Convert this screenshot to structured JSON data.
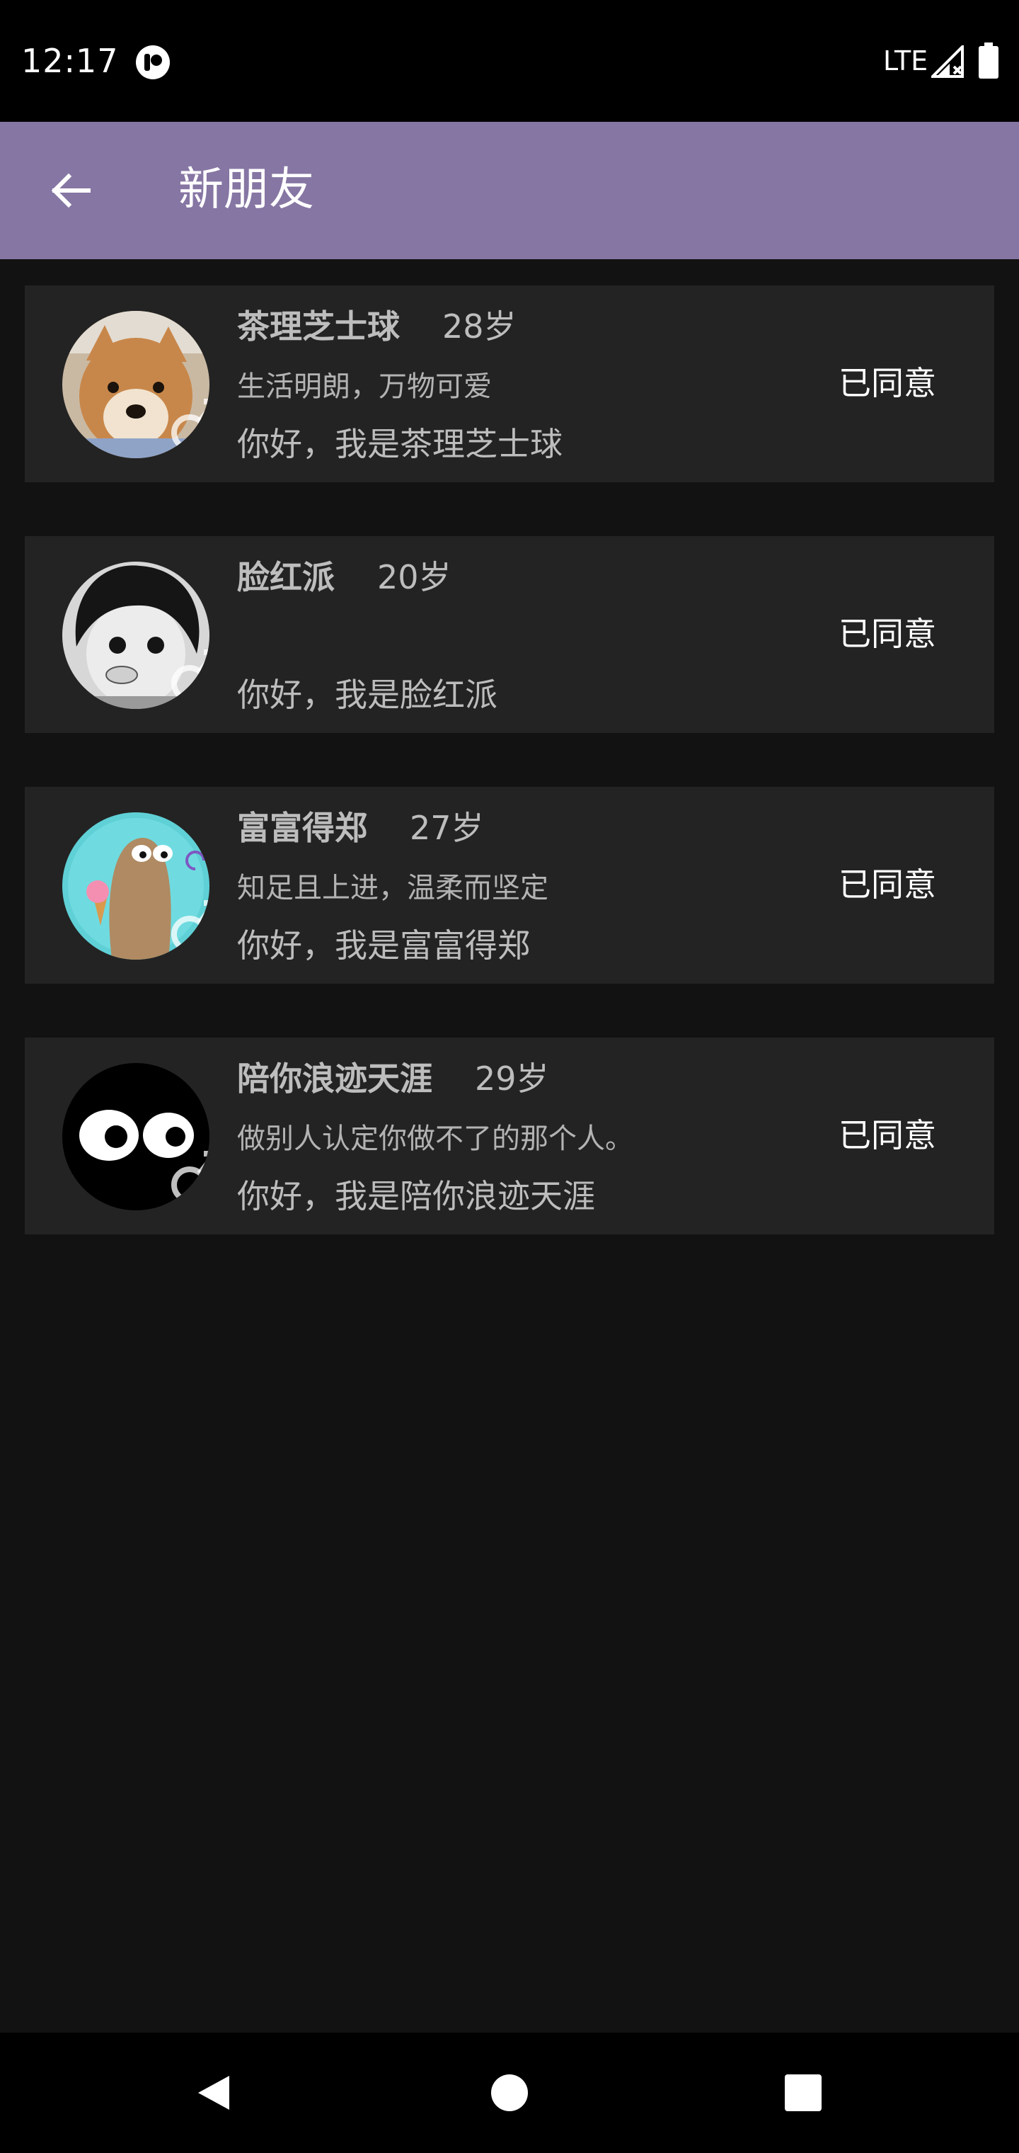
{
  "status_bar": {
    "time": "12:17",
    "network": "LTE",
    "icons": [
      "notification-icon",
      "signal-icon",
      "battery-icon"
    ]
  },
  "app_bar": {
    "title": "新朋友",
    "back_icon": "arrow-left-icon",
    "color": "#8676a3"
  },
  "friends": [
    {
      "name": "茶理芝士球",
      "age": "28岁",
      "signature": "生活明朗，万物可爱",
      "greeting": "你好，我是茶理芝士球",
      "status": "已同意",
      "avatar": "shiba-dog-avatar",
      "gender_icon": "male-icon"
    },
    {
      "name": "脸红派",
      "age": "20岁",
      "signature": "",
      "greeting": "你好，我是脸红派",
      "status": "已同意",
      "avatar": "anime-boy-avatar",
      "gender_icon": "male-icon"
    },
    {
      "name": "富富得郑",
      "age": "27岁",
      "signature": "知足且上进，温柔而坚定",
      "greeting": "你好，我是富富得郑",
      "status": "已同意",
      "avatar": "cartoon-icecream-avatar",
      "gender_icon": "male-icon"
    },
    {
      "name": "陪你浪迹天涯",
      "age": "29岁",
      "signature": "做别人认定你做不了的那个人。",
      "greeting": "你好，我是陪你浪迹天涯",
      "status": "已同意",
      "avatar": "cartoon-eyes-avatar",
      "gender_icon": "male-icon"
    }
  ],
  "nav_bar": {
    "icons": [
      "nav-back-icon",
      "nav-home-icon",
      "nav-recents-icon"
    ]
  },
  "colors": {
    "background": "#121212",
    "card": "#232323",
    "text_primary": "#ffffff",
    "text_secondary": "#bdbdbd"
  }
}
